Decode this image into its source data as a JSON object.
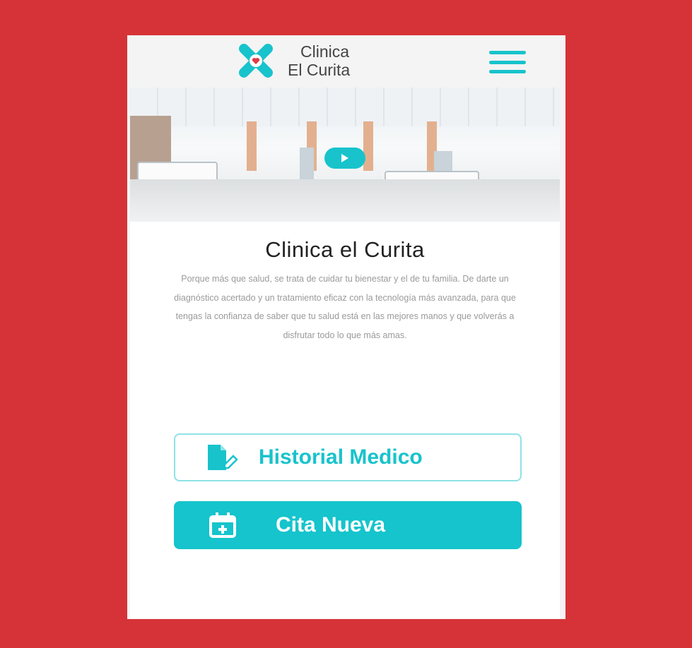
{
  "app": {
    "logo_line1": "Clinica",
    "logo_line2": "El Curita",
    "brand_color": "#18c3cc",
    "background_color": "#d63338",
    "menu_icon": "hamburger-menu-icon",
    "logo_icon": "cross-heart-logo-icon"
  },
  "hero": {
    "play_icon": "play-icon"
  },
  "main": {
    "title": "Clinica el Curita",
    "description": "Porque más que salud, se trata de cuidar tu bienestar y el de tu familia. De darte un diagnóstico acertado y un tratamiento eficaz con la tecnología más avanzada, para que tengas la confianza de saber que tu salud está en las mejores manos y que volverás a disfrutar todo lo que más amas."
  },
  "actions": {
    "history_label": "Historial Medico",
    "history_icon": "medical-record-icon",
    "appointment_label": "Cita Nueva",
    "appointment_icon": "calendar-add-icon"
  }
}
